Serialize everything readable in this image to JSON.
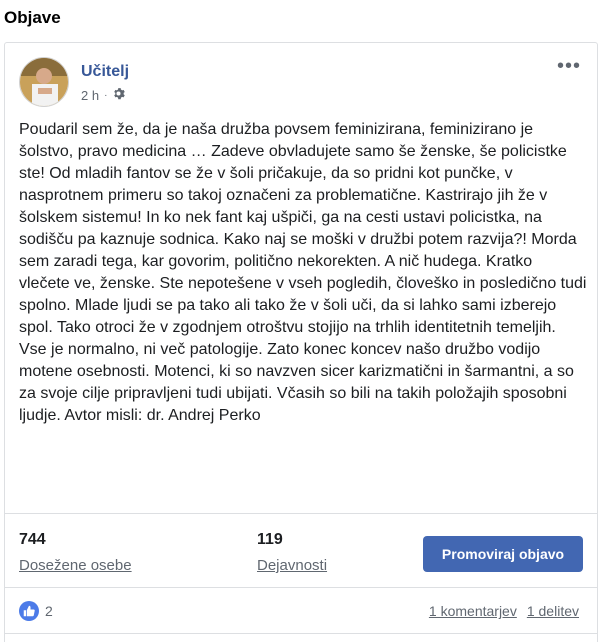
{
  "section": {
    "title": "Objave"
  },
  "post": {
    "author": "Učitelj",
    "time": "2 h",
    "visibility_icon": "gear-icon",
    "more_icon": "more-options-icon",
    "text": "Poudaril sem že, da je naša družba povsem feminizirana, feminizirano je šolstvo, pravo medicina … Zadeve obvladujete samo še ženske, še policistke ste! Od mladih fantov se že v šoli pričakuje, da so pridni kot punčke, v nasprotnem primeru so takoj označeni za problematične. Kastrirajo jih že v šolskem sistemu! In ko nek fant kaj ušpiči, ga na cesti ustavi policistka, na sodišču pa kaznuje sodnica. Kako naj se moški v družbi potem razvija?! Morda sem zaradi tega, kar govorim, politično nekorekten. A nič hudega. Kratko vlečete ve, ženske. Ste nepotešene v vseh pogledih, človeško in posledično tudi spolno. Mlade ljudi se pa tako ali tako že v šoli uči, da si lahko sami izberejo spol. Tako otroci že v zgodnjem otroštvu stojijo na trhlih identitetnih temeljih. Vse je normalno, ni več patologije. Zato konec koncev našo družbo vodijo motene osebnosti. Motenci, ki so navzven sicer karizmatični in šarmantni, a so za svoje cilje pripravljeni tudi ubijati. Včasih so bili na takih položajih sposobni ljudje. Avtor misli: dr. Andrej Perko"
  },
  "insights": {
    "reach_value": "744",
    "reach_label": "Dosežene osebe",
    "engagement_value": "119",
    "engagement_label": "Dejavnosti",
    "promote_label": "Promoviraj objavo"
  },
  "footer": {
    "reaction_icon": "like-icon",
    "reaction_count": "2",
    "comments_link": "1 komentarjev",
    "shares_link": "1 delitev"
  },
  "colors": {
    "author": "#385898",
    "button": "#4267b2",
    "like": "#4c7be8"
  }
}
